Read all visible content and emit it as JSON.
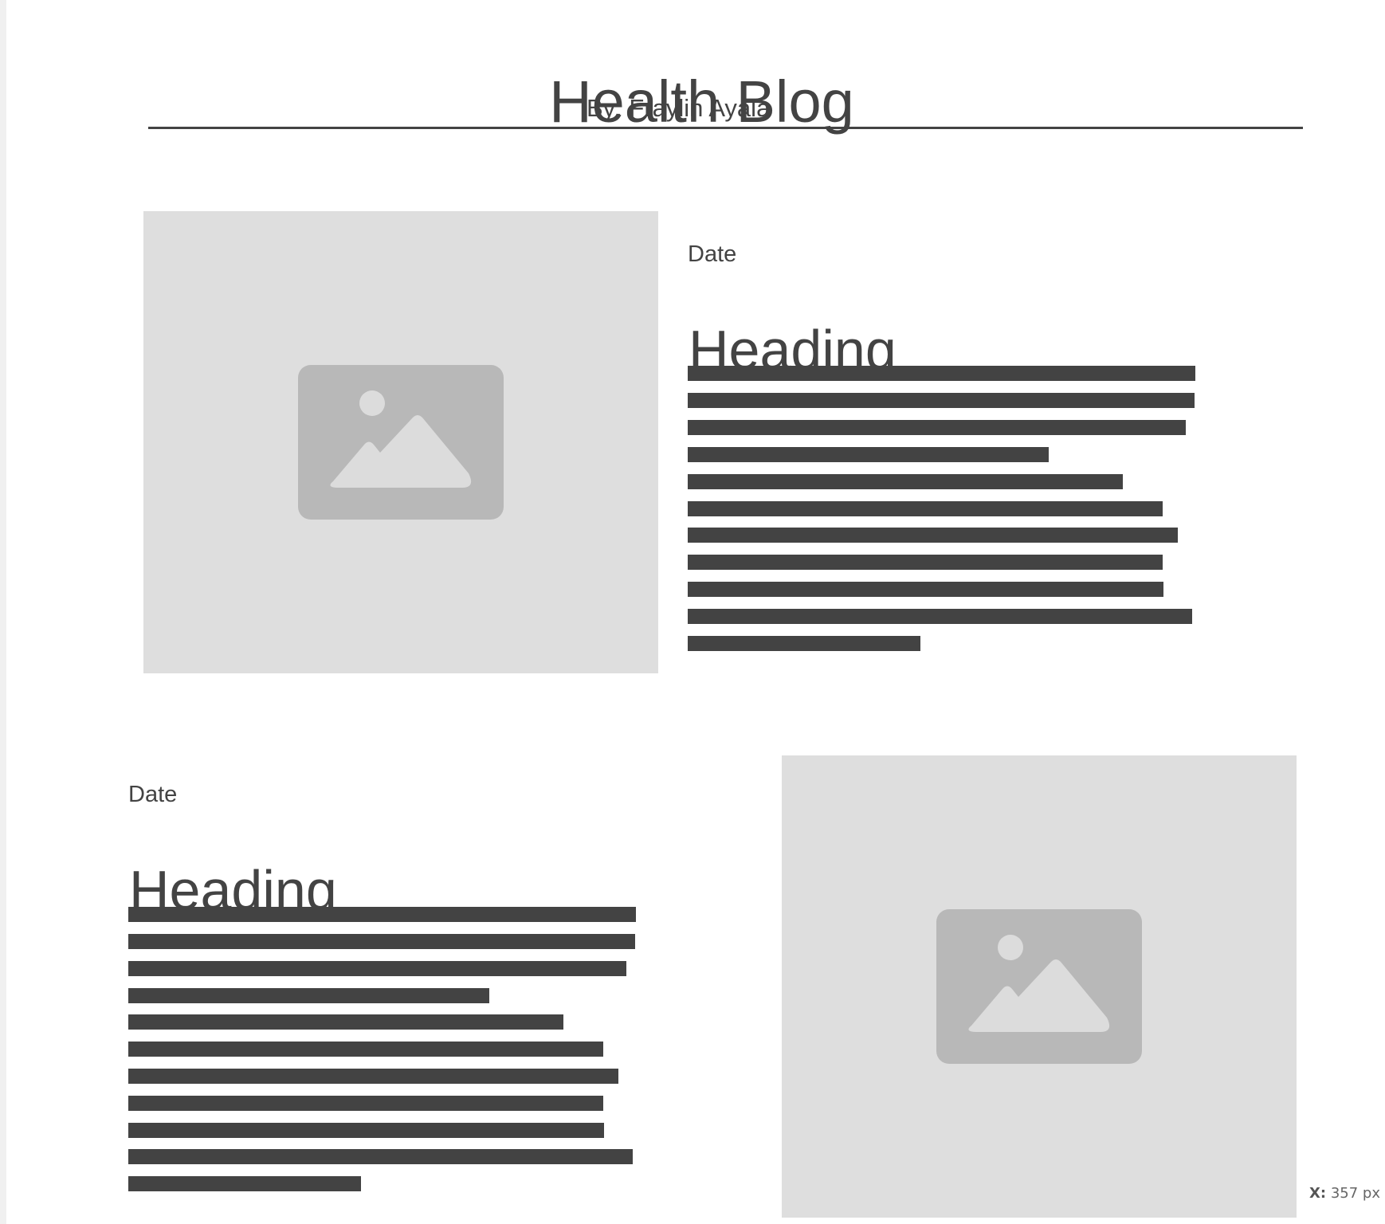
{
  "header": {
    "title": "Health Blog",
    "byline": "By: Fraylin Ayala"
  },
  "posts": [
    {
      "date": "Date",
      "heading": "Heading",
      "image_icon": "image-placeholder-icon",
      "text_line_count": 11
    },
    {
      "date": "Date",
      "heading": "Heading",
      "image_icon": "image-placeholder-icon",
      "text_line_count": 11
    }
  ],
  "coordinate_readout": {
    "label": "X:",
    "value": "357 px"
  },
  "colors": {
    "text": "#434343",
    "image_background": "#dedede",
    "icon": "#b8b8b8",
    "icon_detail": "#dcdcdc",
    "page_background": "#ffffff",
    "outer_background": "#f0f0f0"
  }
}
